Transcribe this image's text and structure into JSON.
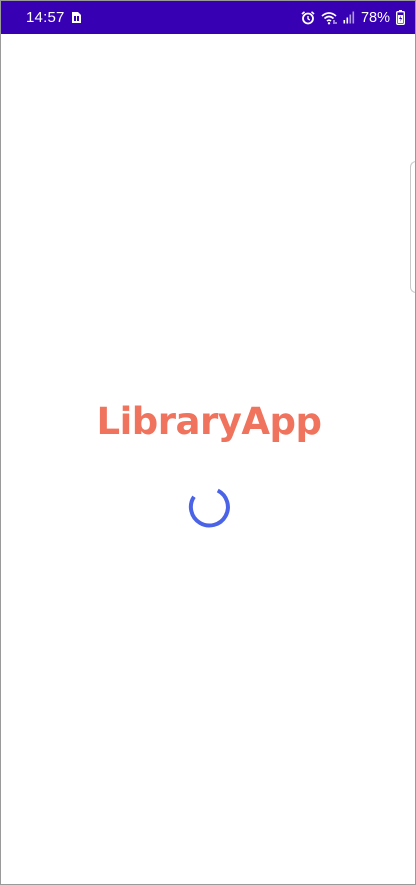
{
  "status_bar": {
    "time": "14:57",
    "battery_percent": "78%",
    "background_color": "#3700b3",
    "icons_left": [
      "sim-card-icon"
    ],
    "icons_right": [
      "alarm-icon",
      "wifi-icon",
      "signal-icon",
      "battery-icon"
    ]
  },
  "splash": {
    "title": "LibraryApp",
    "title_color": "#f0735d",
    "spinner_color": "#4a63e7"
  }
}
